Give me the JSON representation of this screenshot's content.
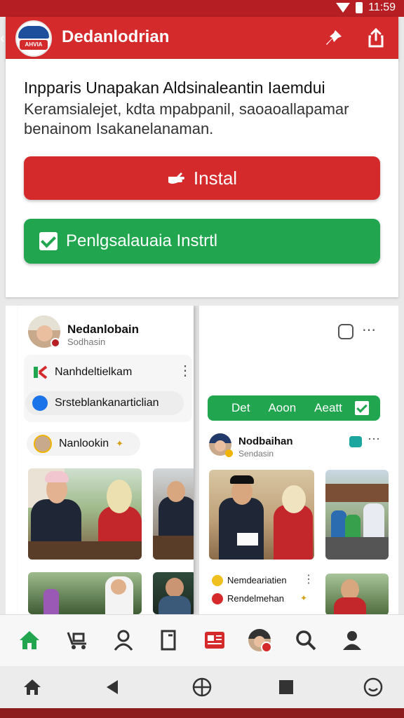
{
  "status_bar": {
    "time": "11:59"
  },
  "app_bar": {
    "logo_text": "AHVIA",
    "title": "Dedanlodrian",
    "actions": [
      "pin-icon",
      "share-icon"
    ]
  },
  "notice": {
    "title": "Inpparis Unapakan Aldsinaleantin Iaemdui",
    "body": "Keramsialejet, kdta mpabpanil, saoaoallapamar benainom Isakanelanaman.",
    "install_button": "Instal",
    "manage_button": "Penlgsalauaia Instrtl"
  },
  "feed": {
    "left_card": {
      "author_name": "Nedanlobain",
      "author_sub": "Sodhasin",
      "menu_items": [
        {
          "icon": "brand-icon",
          "label": "Nanhdeltielkam"
        },
        {
          "icon": "verified-icon",
          "label": "Srsteblankanarticlian"
        }
      ],
      "secondary_chip": "Nanlookin",
      "photos": [
        "teacher-and-woman-at-table",
        "woman-in-red-hijab",
        "man-at-table",
        "garden-group",
        "hijab-woman-outdoors",
        "man-portrait"
      ]
    },
    "right_card": {
      "action_bar_labels": [
        "Det",
        "Aoon",
        "Aeatt"
      ],
      "author_name": "Nodbaihan",
      "author_sub": "Sendasin",
      "tags": [
        {
          "icon": "brand-icon",
          "label": "Nemdeariatien"
        },
        {
          "icon": "brand-icon",
          "label": "Rendelmehan"
        }
      ],
      "photos": [
        "man-and-woman-with-papers",
        "people-at-village-table",
        "group-outdoor",
        "man-in-red-shirt"
      ]
    }
  },
  "tab_bar": {
    "items": [
      "home-icon",
      "delivery-icon",
      "person-icon",
      "bookmark-icon",
      "news-icon",
      "profile-avatar",
      "search-icon",
      "account-icon"
    ],
    "active": "home-icon"
  },
  "nav_bar": {
    "items": [
      "home-icon",
      "back-icon",
      "globe-icon",
      "square-icon",
      "smile-icon"
    ]
  },
  "colors": {
    "primary_red": "#d42a2b",
    "dark_red": "#b51f24",
    "primary_green": "#21a64f",
    "accent_blue": "#1a73e8"
  }
}
